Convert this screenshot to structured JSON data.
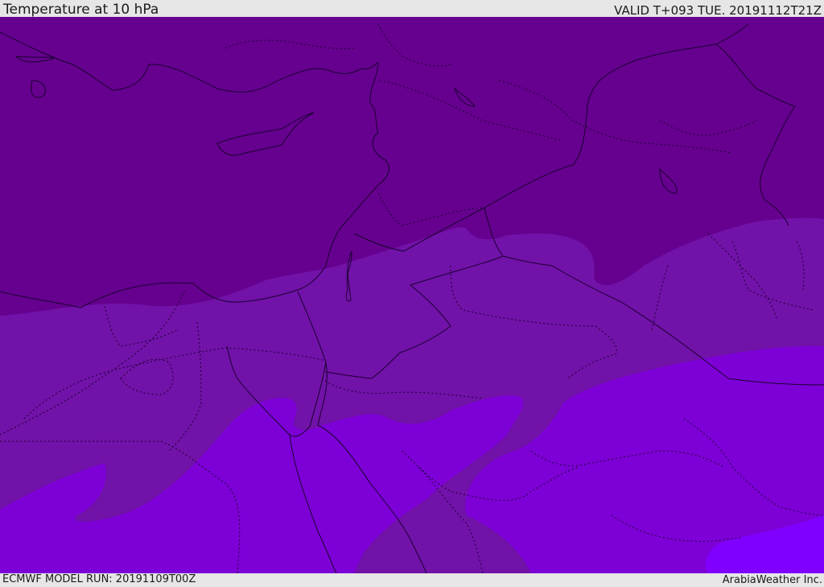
{
  "header": {
    "title": "Temperature at 10 hPa",
    "valid_time": "VALID T+093 TUE. 20191112T21Z"
  },
  "footer": {
    "model_run": "ECMWF MODEL RUN: 20191109T00Z",
    "credit": "ArabiaWeather Inc."
  },
  "map": {
    "colors": {
      "coldest_band": "#66008f",
      "band_2": "#7112a8",
      "band_3": "#7d00d6",
      "warmest_band": "#7f00ff",
      "coastline": "#1a0030"
    }
  }
}
